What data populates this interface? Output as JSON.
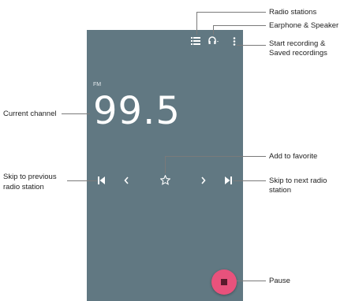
{
  "screen": {
    "band_label": "FM",
    "frequency": "99.5",
    "accent_color": "#e8527c",
    "background_color": "#617882"
  },
  "icons": {
    "list": "list-icon",
    "headphones": "headphones-icon",
    "more": "more-vert-icon",
    "skip_previous": "skip-previous-icon",
    "previous": "chevron-left-icon",
    "favorite": "star-outline-icon",
    "next": "chevron-right-icon",
    "skip_next": "skip-next-icon",
    "pause": "stop-square-icon"
  },
  "callouts": {
    "radio_stations": "Radio stations",
    "earphone_speaker": "Earphone & Speaker",
    "recording_line1": "Start recording &",
    "recording_line2": "Saved recordings",
    "current_channel": "Current channel",
    "add_favorite": "Add to favorite",
    "skip_prev_line1": "Skip to previous",
    "skip_prev_line2": "radio station",
    "skip_next_line1": "Skip to next radio",
    "skip_next_line2": "station",
    "pause": "Pause"
  }
}
